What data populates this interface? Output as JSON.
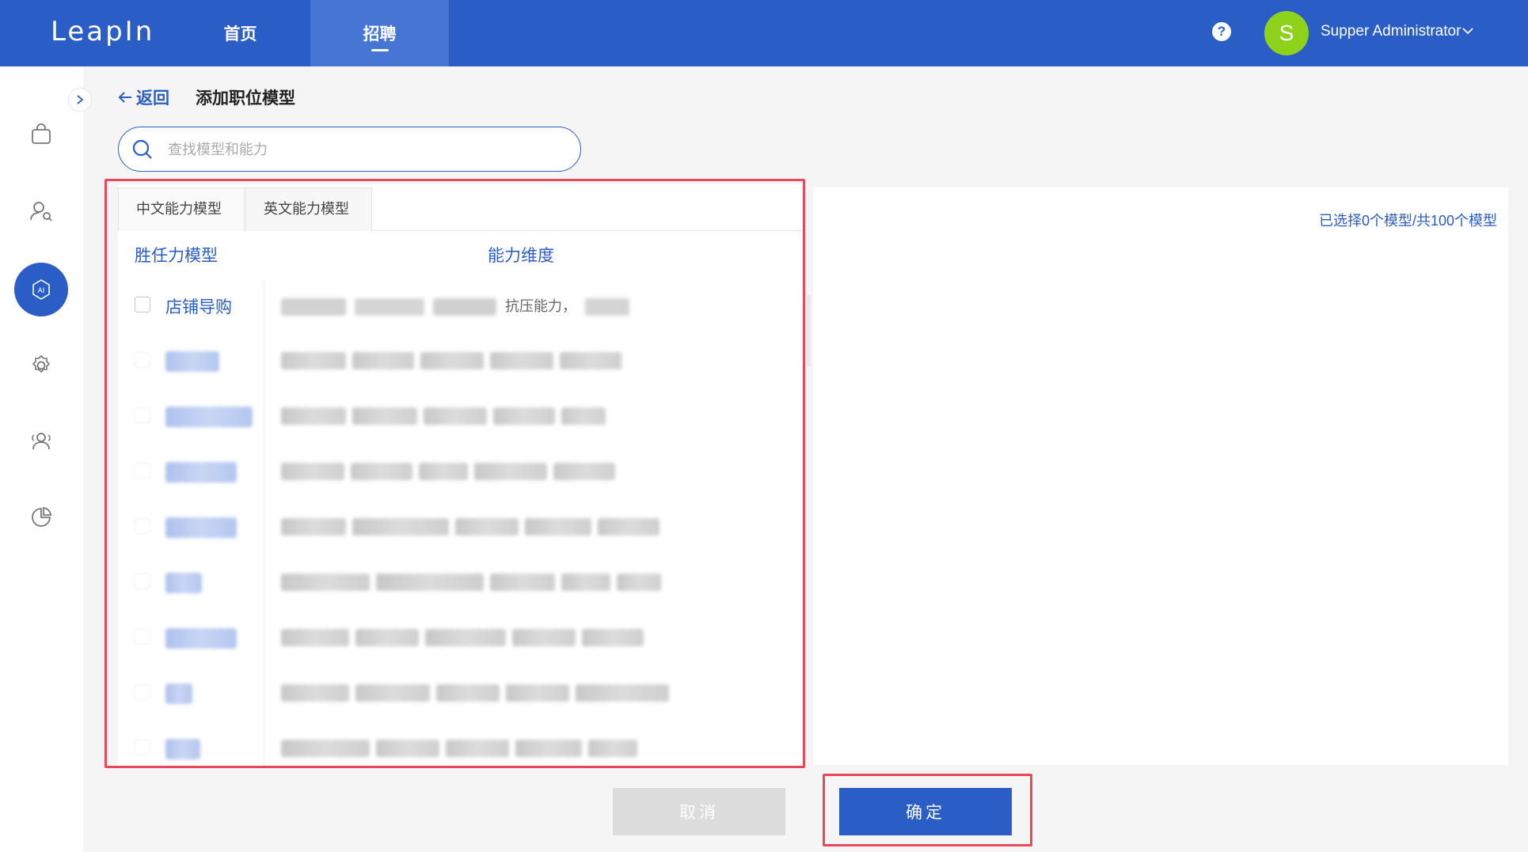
{
  "header": {
    "logo": "LeapIn",
    "nav": [
      {
        "label": "首页"
      },
      {
        "label": "招聘"
      }
    ],
    "help": "?",
    "avatar_letter": "S",
    "user_name": "Supper Administrator"
  },
  "page": {
    "back_label": "返回",
    "title": "添加职位模型"
  },
  "search": {
    "placeholder": "查找模型和能力",
    "value": ""
  },
  "tabs": [
    {
      "label": "中文能力模型",
      "active": true
    },
    {
      "label": "英文能力模型",
      "active": false
    }
  ],
  "columns": {
    "model": "胜任力模型",
    "dimensions": "能力维度"
  },
  "rows": [
    {
      "name": "店铺导购",
      "dimensions": "抗压能力，"
    }
  ],
  "right_panel": {
    "selected_count": "已选择0个模型/共100个模型"
  },
  "buttons": {
    "cancel": "取消",
    "confirm": "确定"
  },
  "colors": {
    "primary": "#2a5dc5",
    "highlight": "#e8485a",
    "avatar": "#8fd21c"
  }
}
